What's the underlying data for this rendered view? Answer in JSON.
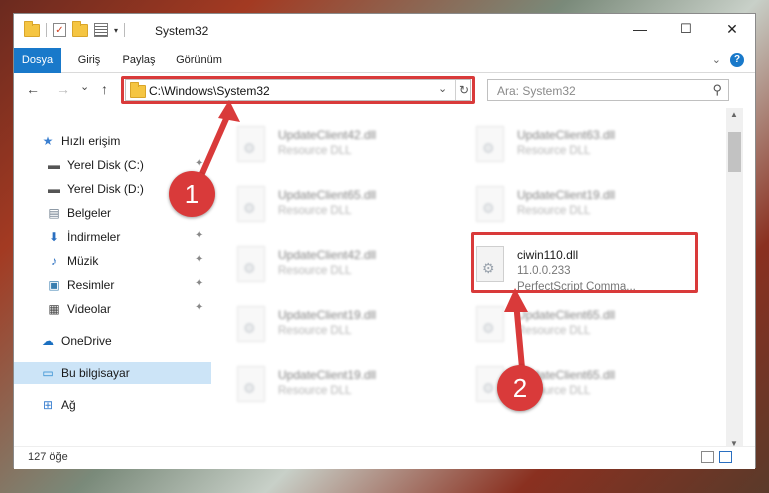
{
  "window": {
    "title": "System32",
    "controls": {
      "minimize": "—",
      "maximize": "☐",
      "close": "✕"
    }
  },
  "ribbon": {
    "tabs": [
      "Dosya",
      "Giriş",
      "Paylaş",
      "Görünüm"
    ],
    "help": "?"
  },
  "nav": {
    "back": "←",
    "forward": "→",
    "recent": "⌄",
    "up": "↑"
  },
  "address": {
    "path": "C:\\Windows\\System32",
    "dropdown": "⌄",
    "refresh": "↻"
  },
  "search": {
    "placeholder": "Ara: System32",
    "icon": "⚲"
  },
  "sidebar": {
    "items": [
      {
        "label": "Hızlı erişim",
        "icon": "star-icon",
        "glyph": "★",
        "color": "#3a7fd0",
        "pinned": false,
        "selected": false
      },
      {
        "label": "Yerel Disk (C:)",
        "icon": "drive-icon",
        "glyph": "▬",
        "color": "#555555",
        "pinned": true,
        "selected": false
      },
      {
        "label": "Yerel Disk (D:)",
        "icon": "drive-icon",
        "glyph": "▬",
        "color": "#555555",
        "pinned": true,
        "selected": false
      },
      {
        "label": "Belgeler",
        "icon": "documents-icon",
        "glyph": "▤",
        "color": "#6a7a8a",
        "pinned": true,
        "selected": false
      },
      {
        "label": "İndirmeler",
        "icon": "download-icon",
        "glyph": "⬇",
        "color": "#2a6fc0",
        "pinned": true,
        "selected": false
      },
      {
        "label": "Müzik",
        "icon": "music-icon",
        "glyph": "♪",
        "color": "#2a6fc0",
        "pinned": true,
        "selected": false
      },
      {
        "label": "Resimler",
        "icon": "pictures-icon",
        "glyph": "▣",
        "color": "#3a7fb0",
        "pinned": true,
        "selected": false
      },
      {
        "label": "Videolar",
        "icon": "video-icon",
        "glyph": "▦",
        "color": "#444444",
        "pinned": true,
        "selected": false
      },
      {
        "label": "OneDrive",
        "icon": "cloud-icon",
        "glyph": "☁",
        "color": "#1a6fc0",
        "pinned": false,
        "selected": false
      },
      {
        "label": "Bu bilgisayar",
        "icon": "computer-icon",
        "glyph": "▭",
        "color": "#2a8ad0",
        "pinned": false,
        "selected": true
      },
      {
        "label": "Ağ",
        "icon": "network-icon",
        "glyph": "⊞",
        "color": "#3a7fd0",
        "pinned": false,
        "selected": false
      }
    ],
    "pin_glyph": "📌"
  },
  "files": [
    {
      "name": "UpdateClient42.dll",
      "type": "Resource DLL",
      "blurred": true
    },
    {
      "name": "UpdateClient63.dll",
      "type": "Resource DLL",
      "blurred": true
    },
    {
      "name": "UpdateClient65.dll",
      "type": "Resource DLL",
      "blurred": true
    },
    {
      "name": "UpdateClient19.dll",
      "type": "Resource DLL",
      "blurred": true
    },
    {
      "name": "UpdateClient42.dll",
      "type": "Resource DLL",
      "blurred": true
    },
    {
      "name": "ciwin110.dll",
      "version": "11.0.0.233",
      "type": "PerfectScript Comma...",
      "blurred": false
    },
    {
      "name": "UpdateClient19.dll",
      "type": "Resource DLL",
      "blurred": true
    },
    {
      "name": "UpdateClient65.dll",
      "type": "Resource DLL",
      "blurred": true
    },
    {
      "name": "UpdateClient19.dll",
      "type": "Resource DLL",
      "blurred": true
    },
    {
      "name": "UpdateClient65.dll",
      "type": "Resource DLL",
      "blurred": true
    }
  ],
  "status": {
    "count": "127 öğe"
  },
  "callouts": [
    "1",
    "2"
  ],
  "colors": {
    "accent": "#1979ca",
    "highlight": "#d93a3a",
    "selected": "#cce4f7"
  }
}
